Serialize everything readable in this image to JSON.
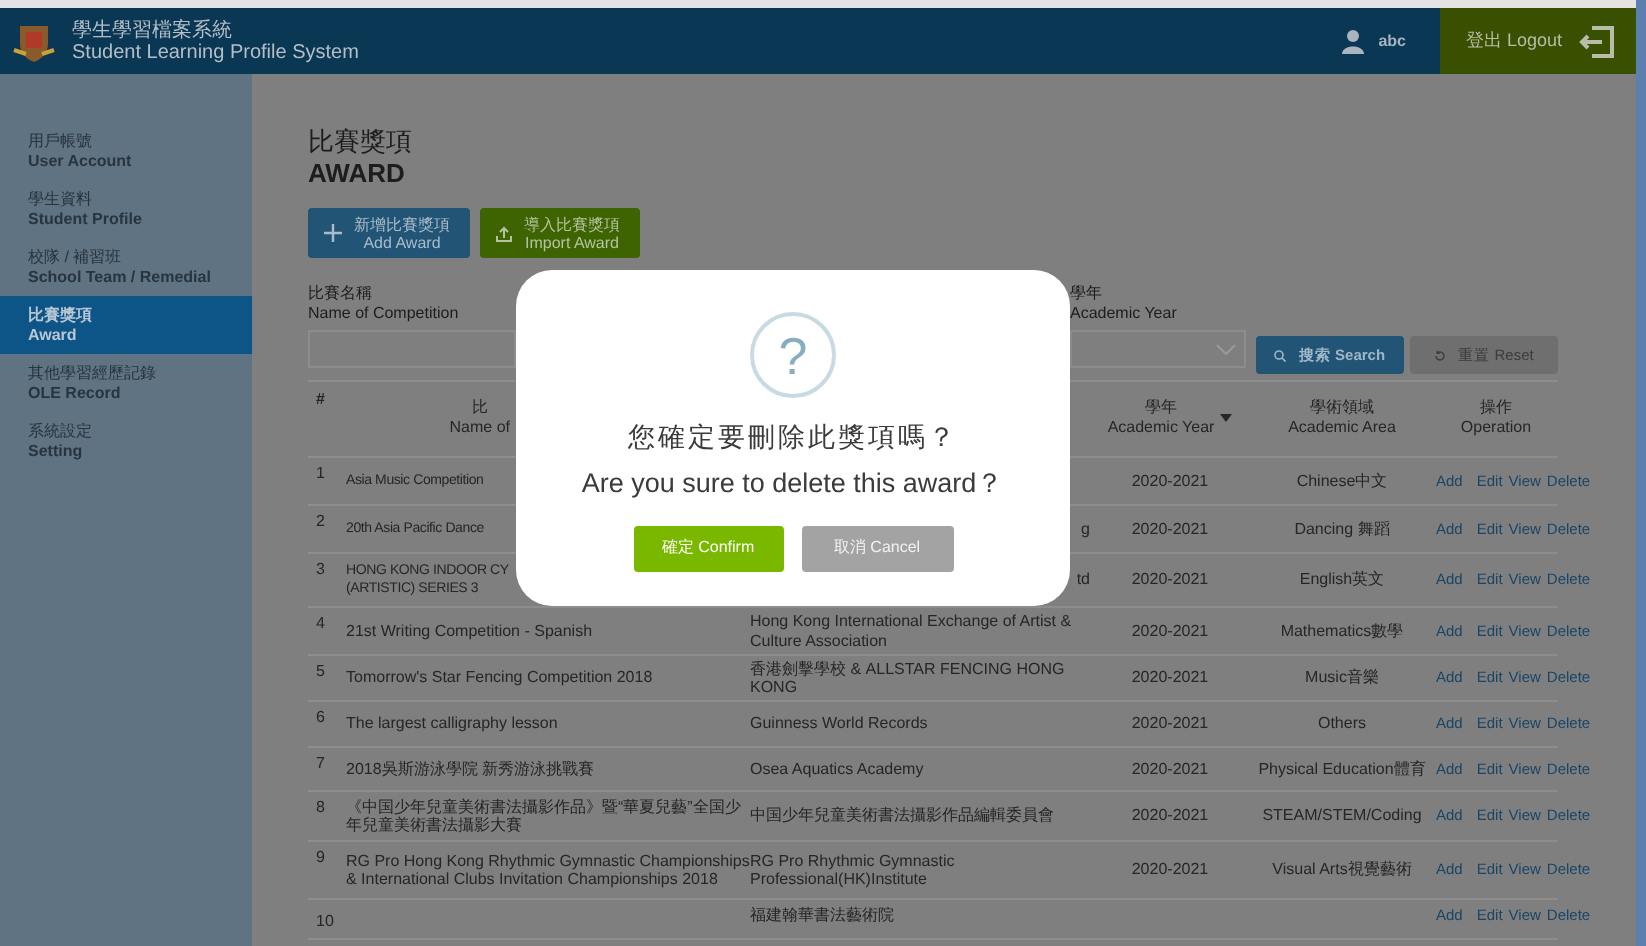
{
  "header": {
    "title_zh": "學生學習檔案系統",
    "title_en": "Student Learning Profile System",
    "user": "abc",
    "logout": "登出 Logout"
  },
  "sidebar": {
    "items": [
      {
        "zh": "用戶帳號",
        "en": "User Account",
        "selected": false
      },
      {
        "zh": "學生資料",
        "en": "Student Profile",
        "selected": false
      },
      {
        "zh": "校隊 / 補習班",
        "en": "School Team / Remedial",
        "selected": false
      },
      {
        "zh": "比賽獎項",
        "en": "Award",
        "selected": true
      },
      {
        "zh": "其他學習經歷記錄",
        "en": "OLE Record",
        "selected": false
      },
      {
        "zh": "系統設定",
        "en": "Setting",
        "selected": false
      }
    ]
  },
  "page": {
    "title_zh": "比賽獎項",
    "title_en": "AWARD"
  },
  "actions": [
    {
      "kind": "add",
      "zh": "新增比賽獎項",
      "en": "Add Award"
    },
    {
      "kind": "import",
      "zh": "導入比賽獎項",
      "en": "Import Award"
    }
  ],
  "filters": {
    "name_label_zh": "比賽名稱",
    "name_label_en": "Name of Competition",
    "year_label_zh": "學年",
    "year_label_en": "Academic Year",
    "search": "搜索 Search",
    "reset": "重置 Reset"
  },
  "table": {
    "columns": [
      {
        "kind": "no",
        "zh": "#"
      },
      {
        "kind": "name",
        "zh": "比",
        "en": "Name of"
      },
      {
        "kind": "year",
        "zh": "學年",
        "en": "Academic Year"
      },
      {
        "kind": "area",
        "zh": "學術領域",
        "en": "Academic Area"
      },
      {
        "kind": "ops",
        "zh": "操作",
        "en": "Operation"
      }
    ],
    "rows": [
      {
        "no": "1",
        "name": "Asia Music Competition",
        "year": "2020-2021",
        "area": "Chinese中文",
        "ops": [
          "Add",
          "Edit",
          "View",
          "Delete"
        ]
      },
      {
        "no": "2",
        "name": "20th Asia Pacific Dance",
        "org": "g",
        "year": "2020-2021",
        "area": "Dancing 舞蹈",
        "ops": [
          "Add",
          "Edit",
          "View",
          "Delete"
        ]
      },
      {
        "no": "3",
        "name": "HONG KONG INDOOR CY\n(ARTISTIC) SERIES 3",
        "org": "td",
        "year": "2020-2021",
        "area": "English英文",
        "ops": [
          "Add",
          "Edit",
          "View",
          "Delete"
        ]
      },
      {
        "no": "4",
        "name": "21st Writing Competition - Spanish",
        "org": "Hong Kong International Exchange of Artist & Culture Association",
        "year": "2020-2021",
        "area": "Mathematics數學",
        "ops": [
          "Add",
          "Edit",
          "View",
          "Delete"
        ]
      },
      {
        "no": "5",
        "name": "Tomorrow's Star Fencing Competition 2018",
        "org": "香港劍擊學校 & ALLSTAR FENCING HONG KONG",
        "year": "2020-2021",
        "area": "Music音樂",
        "ops": [
          "Add",
          "Edit",
          "View",
          "Delete"
        ]
      },
      {
        "no": "6",
        "name": "The largest calligraphy lesson",
        "org": "Guinness World Records",
        "year": "2020-2021",
        "area": "Others",
        "ops": [
          "Add",
          "Edit",
          "View",
          "Delete"
        ]
      },
      {
        "no": "7",
        "name": "2018吳斯游泳學院 新秀游泳挑戰賽",
        "org": "Osea Aquatics Academy",
        "year": "2020-2021",
        "area": "Physical Education體育",
        "ops": [
          "Add",
          "Edit",
          "View",
          "Delete"
        ]
      },
      {
        "no": "8",
        "name": "《中国少年兒童美術書法攝影作品》暨“華夏兒藝”全国少年兒童美術書法攝影大賽",
        "org": "中国少年兒童美術書法攝影作品編輯委員會",
        "year": "2020-2021",
        "area": "STEAM/STEM/Coding",
        "ops": [
          "Add",
          "Edit",
          "View",
          "Delete"
        ]
      },
      {
        "no": "9",
        "name": "RG Pro Hong Kong Rhythmic Gymnastic Championships & International Clubs Invitation Championships 2018",
        "org": "RG Pro Rhythmic Gymnastic Professional(HK)Institute",
        "year": "2020-2021",
        "area": "Visual Arts視覺藝術",
        "ops": [
          "Add",
          "Edit",
          "View",
          "Delete"
        ]
      },
      {
        "no": "10",
        "org": "福建翰華書法藝術院",
        "ops": [
          "Add",
          "Edit",
          "View",
          "Delete"
        ]
      }
    ]
  },
  "dialog": {
    "icon": "?",
    "message_zh": "您確定要刪除此獎項嗎？",
    "message_en": "Are you sure to delete this award？",
    "confirm": "確定 Confirm",
    "cancel": "取消 Cancel"
  }
}
